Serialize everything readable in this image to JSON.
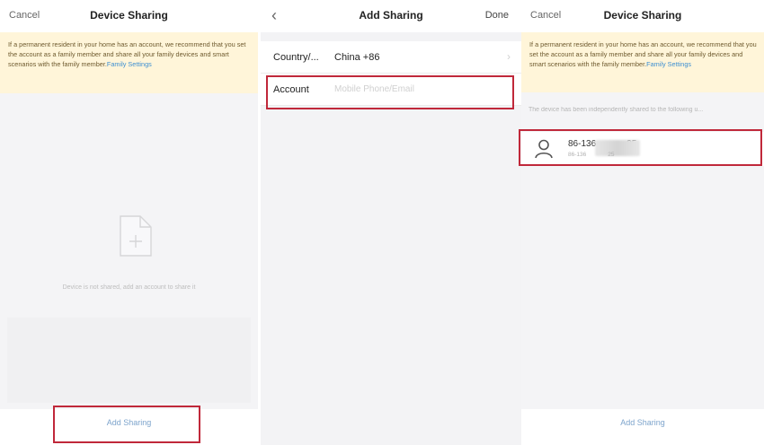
{
  "screen1": {
    "cancel": "Cancel",
    "title": "Device Sharing",
    "notice_text": "If a permanent resident in your home has an account, we recommend that you set the account as a family member and share all your family devices and smart scenarios with the family member.",
    "notice_link": "Family Settings",
    "empty_text": "Device is not shared, add an account to share it",
    "add_sharing": "Add Sharing"
  },
  "screen2": {
    "back_icon": "chevron-left-icon",
    "title": "Add Sharing",
    "done": "Done",
    "country_label": "Country/...",
    "country_value": "China +86",
    "account_label": "Account",
    "account_placeholder": "Mobile Phone/Email"
  },
  "screen3": {
    "cancel": "Cancel",
    "title": "Device Sharing",
    "notice_text": "If a permanent resident in your home has an account, we recommend that you set the account as a family member and share all your family devices and smart scenarios with the family member.",
    "notice_link": "Family Settings",
    "shared_info": "The device has been independently shared to the following u...",
    "user_main_prefix": "86-136",
    "user_main_suffix": "25",
    "user_sub_prefix": "86-136",
    "user_sub_suffix": "25",
    "add_sharing": "Add Sharing"
  },
  "colors": {
    "highlight": "#c0283a",
    "notice_bg": "#fff5d9",
    "link": "#3d8fd1"
  }
}
